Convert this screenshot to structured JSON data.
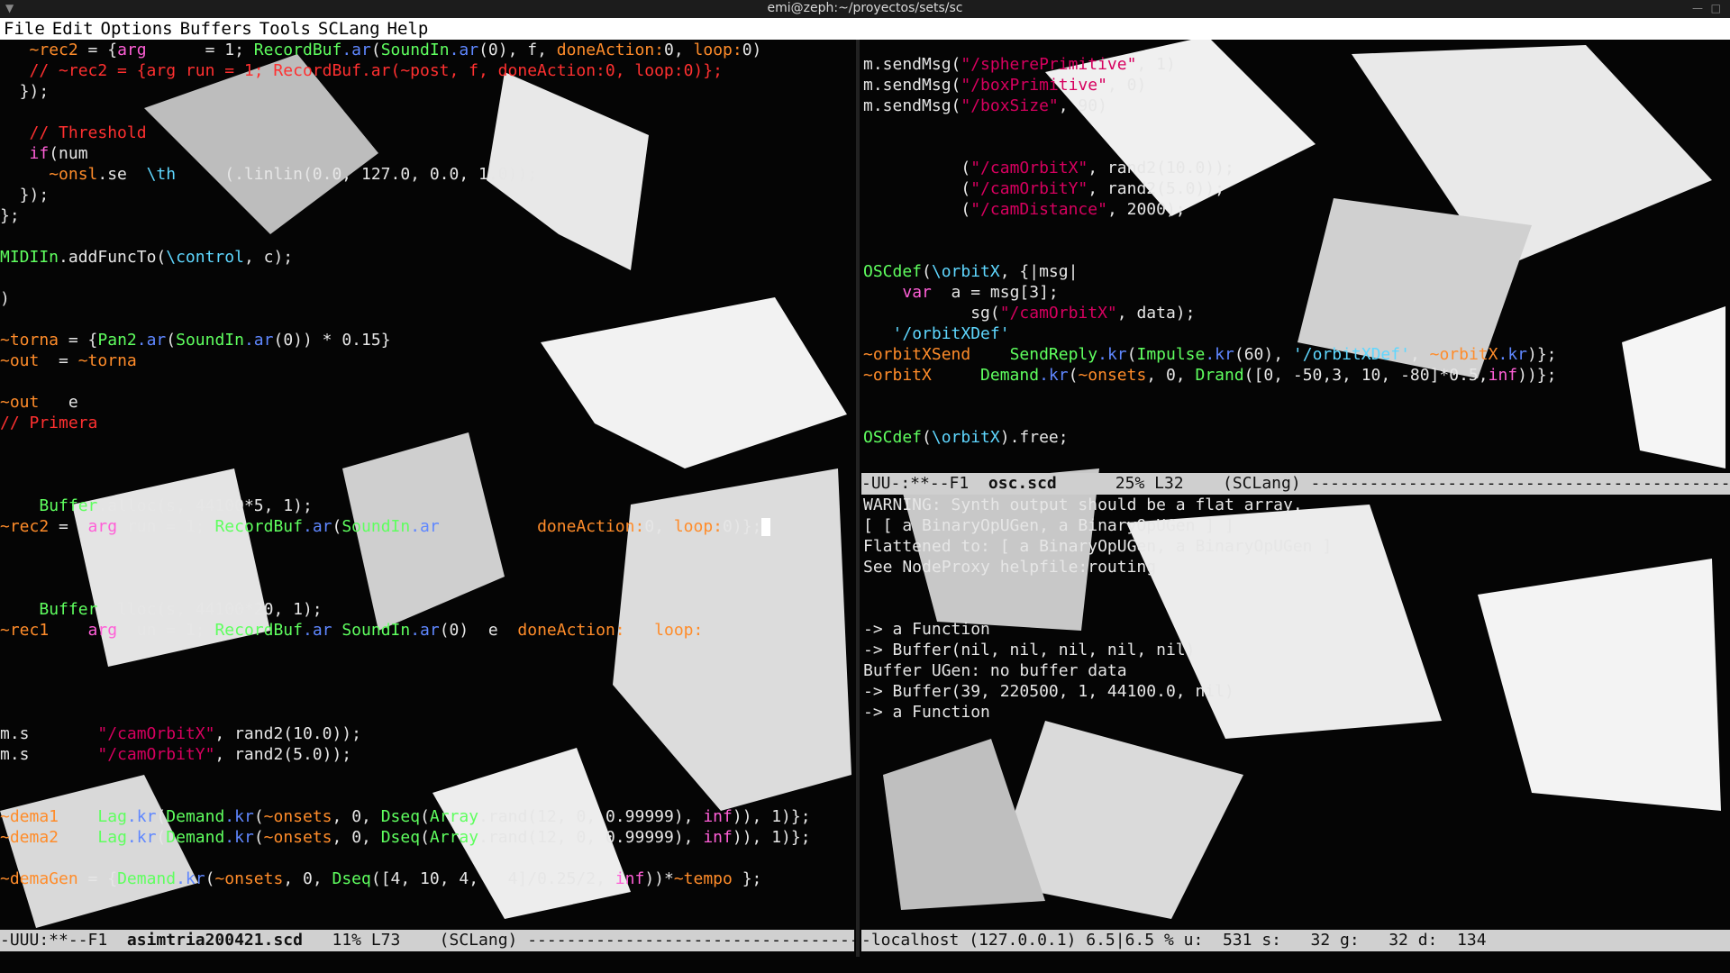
{
  "window": {
    "title": "emi@zeph:~/proyectos/sets/sc"
  },
  "menu": [
    "File",
    "Edit",
    "Options",
    "Buffers",
    "Tools",
    "SCLang",
    "Help"
  ],
  "editor_left": {
    "lines": [
      "   ~rec2 = {arg      = 1; RecordBuf.ar(SoundIn.ar(0), f, doneAction:0, loop:0)",
      "   // ~rec2 = {arg run = 1; RecordBuf.ar(~post, f, doneAction:0, loop:0)};",
      "  });",
      "",
      "   // Threshold",
      "   if(num",
      "     ~onsl.se  \\th     (.linlin(0.0, 127.0, 0.0, 1.0));",
      "  });",
      "};",
      "",
      "MIDIIn.addFuncTo(\\control, c);",
      "",
      ")",
      "",
      "~torna = {Pan2.ar(SoundIn.ar(0)) * 0.15}",
      "~out  = ~torna",
      "",
      "~out   e",
      "// Primera",
      "",
      "",
      "",
      "    Buffer.alloc(s, 44100*5, 1);",
      "~rec2 =  arg run = 1; RecordBuf.ar(SoundIn.ar          doneAction:0, loop:0)};",
      "",
      "",
      "",
      "    Buffer  lloc(s, 44100*20, 1);",
      "~rec1    arg  un = 1; RecordBuf.ar SoundIn.ar(0)  e  doneAction:   loop:",
      "",
      "",
      "",
      "",
      "m.s       \"/camOrbitX\", rand2(10.0));",
      "m.s       \"/camOrbitY\", rand2(5.0));",
      "",
      "",
      "~dema1    Lag.kr(Demand.kr(~onsets, 0, Dseq(Array.rand(12, 0, 0.99999), inf)), 1)};",
      "~dema2    Lag.kr(Demand.kr(~onsets, 0, Dseq(Array.rand(12, 0, 0.99999), inf)), 1)};",
      "",
      "~demaGen = {Demand.kr(~onsets, 0, Dseq([4, 10, 4,   4]/0.25/2, inf))*~tempo };"
    ]
  },
  "editor_right_top": {
    "lines": [
      "m.sendMsg(\"/spherePrimitive\", 1)",
      "m.sendMsg(\"/boxPrimitive\", 0)",
      "m.sendMsg(\"/boxSize\", 90)",
      "",
      "",
      "          (\"/camOrbitX\", rand2(10.0));",
      "          (\"/camOrbitY\", rand2(5.0));",
      "          (\"/camDistance\", 2000);",
      "",
      "",
      "OSCdef(\\orbitX, {|msg|",
      "    var  a = msg[3];",
      "           sg(\"/camOrbitX\", data);",
      "   '/orbitXDef'",
      "~orbitXSend    SendReply.kr(Impulse.kr(60), '/orbitXDef', ~orbitX.kr)};",
      "~orbitX     Demand.kr(~onsets, 0, Drand([0, -50,3, 10, -80]*0.5,inf))};",
      "",
      "",
      "OSCdef(\\orbitX).free;"
    ]
  },
  "editor_right_bottom": {
    "lines": [
      "WARNING: Synth output should be a flat array.",
      "[ [ a BinaryOpUGen, a BinaryOpUGen ] ]",
      "Flattened to: [ a BinaryOpUGen, a BinaryOpUGen ]",
      "See NodeProxy helpfile:routing",
      "",
      "",
      "-> a Function",
      "-> Buffer(nil, nil, nil, nil, nil)",
      "Buffer UGen: no buffer data",
      "-> Buffer(39, 220500, 1, 44100.0, nil)",
      "-> a Function"
    ]
  },
  "modelines": {
    "left": {
      "prefix": "-UUU:**--F1  ",
      "file": "asimtria200421.scd",
      "suffix": "   11% L73    (SCLang) ------------------------------------"
    },
    "right_top": {
      "prefix": "-UU-:**--F1  ",
      "file": "osc.scd",
      "suffix": "      25% L32    (SCLang) ------------------------------------------------"
    },
    "right_bottom": {
      "text": "-localhost (127.0.0.1) 6.5|6.5 % u:  531 s:   32 g:   32 d:  134"
    }
  },
  "colors": {
    "menubar_bg": "#ffffff",
    "modeline_bg": "#d0d0d0",
    "keyword": "#ff5fd7",
    "class": "#5fff5f",
    "method": "#5f87ff",
    "symbol": "#5fd7ff",
    "string": "#d7005f",
    "env_var": "#ff8c2a",
    "comment": "#ff3030"
  }
}
